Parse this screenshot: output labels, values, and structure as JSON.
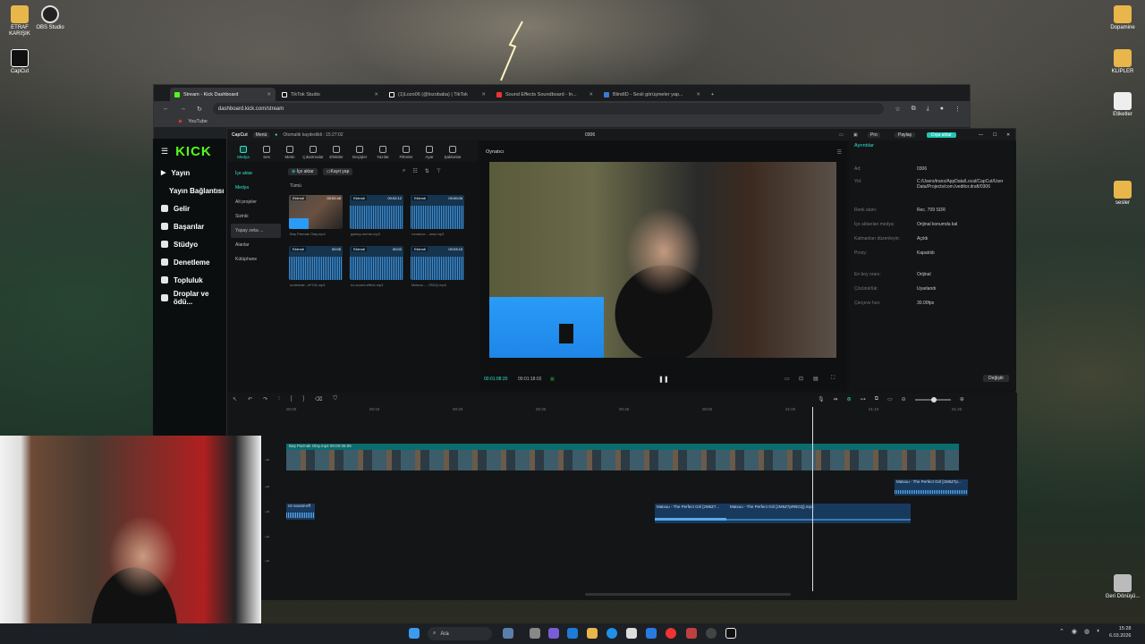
{
  "desktop": {
    "icons_left": [
      {
        "label": "ETRAF KARIŞIK",
        "color": "#e8b64a"
      },
      {
        "label": "OBS Studio",
        "color": "#333"
      },
      {
        "label": "CapCut",
        "color": "#111"
      }
    ],
    "icons_right": [
      {
        "label": "Dopamine",
        "color": "#e8b64a"
      },
      {
        "label": "KLİPLER",
        "color": "#e8b64a"
      },
      {
        "label": "Etiketler",
        "color": "#eee"
      },
      {
        "label": "sesler",
        "color": "#e8b64a"
      },
      {
        "label": "Geri Dönüşü...",
        "color": "#ccc"
      }
    ]
  },
  "browser": {
    "tabs": [
      {
        "label": "Stream - Kick Dashboard",
        "color": "#53fc18"
      },
      {
        "label": "TikTok Studio",
        "color": "#111"
      },
      {
        "label": "(1)Lozo06 (@lozobaba) | TikTok",
        "color": "#111"
      },
      {
        "label": "Sound Effects Soundboard - In...",
        "color": "#e33"
      },
      {
        "label": "BlindID - Sesli görüşmeler yap...",
        "color": "#3a7bd5"
      }
    ],
    "url": "dashboard.kick.com/stream",
    "bookmark": "YouTube"
  },
  "kick": {
    "logo": "KICK",
    "items": [
      "Yayın",
      "Yayın Bağlantısı",
      "Gelir",
      "Başarılar",
      "Stüdyo",
      "Denetleme",
      "Topluluk",
      "Droplar ve ödü..."
    ]
  },
  "capcut": {
    "app": "CapCut",
    "menu": "Menü",
    "autosave": "Otomatik kaydedildi : 15:27:02",
    "project": "0306",
    "pro": "Pro",
    "share": "Paylaş",
    "export": "Dışa aktar",
    "tools": [
      "Medya",
      "Ses",
      "Metin",
      "Çıkartmalar",
      "Efektler",
      "Geçişler",
      "Yazılar",
      "Filtreler",
      "Ayar",
      "Şablonlar"
    ],
    "media_nav": [
      "İçe aktar",
      "Medya",
      "Alt projeler",
      "Sizinki",
      "Yapay zeka ...",
      "Alanlar",
      "Kütüphane"
    ],
    "import_btn": "İçe aktar",
    "record_btn": "Kayıt yap",
    "all": "Tümü",
    "thumbs": [
      {
        "tag": "Eklendi",
        "dur": "00:02:48",
        "cap": "Baş Parmak Olay.mp4",
        "video": true
      },
      {
        "tag": "Eklendi",
        "dur": "00:02:12",
        "cap": "galaxy-meme.mp3"
      },
      {
        "tag": "Eklendi",
        "dur": "00:00:06",
        "cap": "romance....awa.mp3"
      },
      {
        "tag": "Eklendi",
        "dur": "00:05",
        "cap": "undertale...eFClk.mp3"
      },
      {
        "tag": "Eklendi",
        "dur": "00:02",
        "cap": "riz-sound-effect.mp3"
      },
      {
        "tag": "Eklendi",
        "dur": "00:03:15",
        "cap": "Matxuu -...7BGQ.mp3"
      }
    ],
    "player_title": "Oynatıcı",
    "time_current": "00:01:08:20",
    "time_total": "00:01:18:02",
    "details_title": "Ayrıntılar",
    "details": [
      {
        "k": "Ad:",
        "v": "0306"
      },
      {
        "k": "Yol:",
        "v": "C:/Users/trans/AppData/Local/CapCut/User Data/Projects/com.lveditor.draft/0306"
      },
      {
        "k": "Renk alanı:",
        "v": "Rec. 709 SDR"
      },
      {
        "k": "İçe aktarılan medya:",
        "v": "Orijinal konumda kal"
      },
      {
        "k": "Katmanları düzenleyin:",
        "v": "Açıldı"
      },
      {
        "k": "Proxy:",
        "v": "Kapatıldı"
      },
      {
        "k": "En boy oranı:",
        "v": "Orijinal"
      },
      {
        "k": "Çözünürlük:",
        "v": "Uyarlandı"
      },
      {
        "k": "Çerçeve hızı:",
        "v": "30.00fps"
      }
    ],
    "modify": "Değiştir",
    "ruler": [
      "00:00",
      "00:10",
      "00:20",
      "00:30",
      "00:40",
      "00:50",
      "01:00",
      "01:10",
      "01:20"
    ],
    "video_clip": "Baş Parmak Olay.mp4  00:00:06:06",
    "audio1": "riz-sound-eff",
    "audio2": "Matxuu - The Perfect Girl [zM5Z7...",
    "audio3": "Matxuu - The Perfect Girl [zM5Z7pRBGQ].mp3",
    "audio4": "Matxuu - The Perfect Girl [zM5Z7p..."
  },
  "taskbar": {
    "search": "Ara",
    "time": "15:28",
    "date": "6.03.2026"
  }
}
